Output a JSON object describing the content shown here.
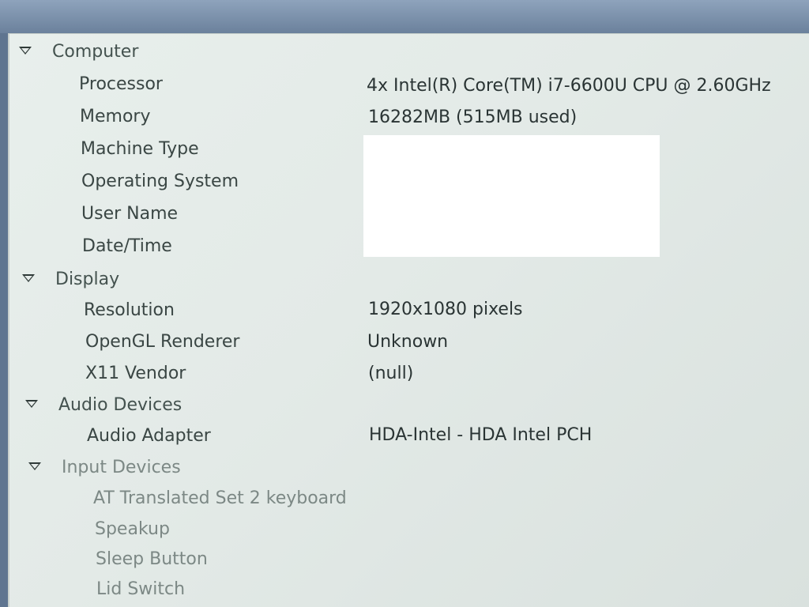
{
  "sections": [
    {
      "label": "Computer",
      "items": [
        {
          "key": "Processor",
          "value": "4x Intel(R) Core(TM) i7-6600U CPU @ 2.60GHz"
        },
        {
          "key": "Memory",
          "value": "16282MB (515MB used)"
        },
        {
          "key": "Machine Type",
          "value": ""
        },
        {
          "key": "Operating System",
          "value": ""
        },
        {
          "key": "User Name",
          "value": ""
        },
        {
          "key": "Date/Time",
          "value": ""
        }
      ]
    },
    {
      "label": "Display",
      "items": [
        {
          "key": "Resolution",
          "value": "1920x1080 pixels"
        },
        {
          "key": "OpenGL Renderer",
          "value": "Unknown"
        },
        {
          "key": "X11 Vendor",
          "value": "(null)"
        }
      ]
    },
    {
      "label": "Audio Devices",
      "items": [
        {
          "key": "Audio Adapter",
          "value": "HDA-Intel - HDA Intel PCH"
        }
      ]
    },
    {
      "label": "Input Devices",
      "items": [
        {
          "key": "AT Translated Set 2 keyboard",
          "value": ""
        },
        {
          "key": "Speakup",
          "value": ""
        },
        {
          "key": "Sleep Button",
          "value": ""
        },
        {
          "key": "Lid Switch",
          "value": ""
        }
      ]
    }
  ],
  "icons": {
    "section_toggle": "triangle-down-icon"
  }
}
